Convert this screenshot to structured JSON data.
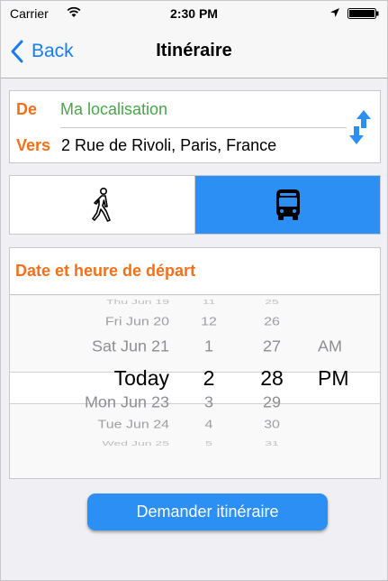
{
  "status_bar": {
    "carrier": "Carrier",
    "time": "2:30 PM"
  },
  "nav": {
    "back_label": "Back",
    "title": "Itinéraire"
  },
  "route": {
    "from_label": "De",
    "from_value": "Ma localisation",
    "to_label": "Vers",
    "to_value": "2 Rue de Rivoli, Paris, France"
  },
  "modes": {
    "selected": "bus",
    "options": [
      "walk",
      "bus"
    ]
  },
  "departure": {
    "header": "Date et heure de départ",
    "picker": {
      "days": [
        "Thu Jun 19",
        "Fri Jun 20",
        "Sat Jun 21",
        "Today",
        "Mon Jun 23",
        "Tue Jun 24",
        "Wed Jun 25"
      ],
      "hours": [
        "11",
        "12",
        "1",
        "2",
        "3",
        "4",
        "5"
      ],
      "minutes": [
        "25",
        "26",
        "27",
        "28",
        "29",
        "30",
        "31"
      ],
      "ampm": [
        "",
        "",
        "AM",
        "PM",
        "",
        "",
        ""
      ],
      "selected_day": "Today",
      "selected_hour": "2",
      "selected_minute": "28",
      "selected_ampm": "PM"
    }
  },
  "actions": {
    "request_label": "Demander itinéraire"
  },
  "colors": {
    "accent_blue": "#2b8ff3",
    "label_orange": "#f2701a",
    "location_green": "#4aa54a",
    "ios_link_blue": "#1a7cf5"
  }
}
